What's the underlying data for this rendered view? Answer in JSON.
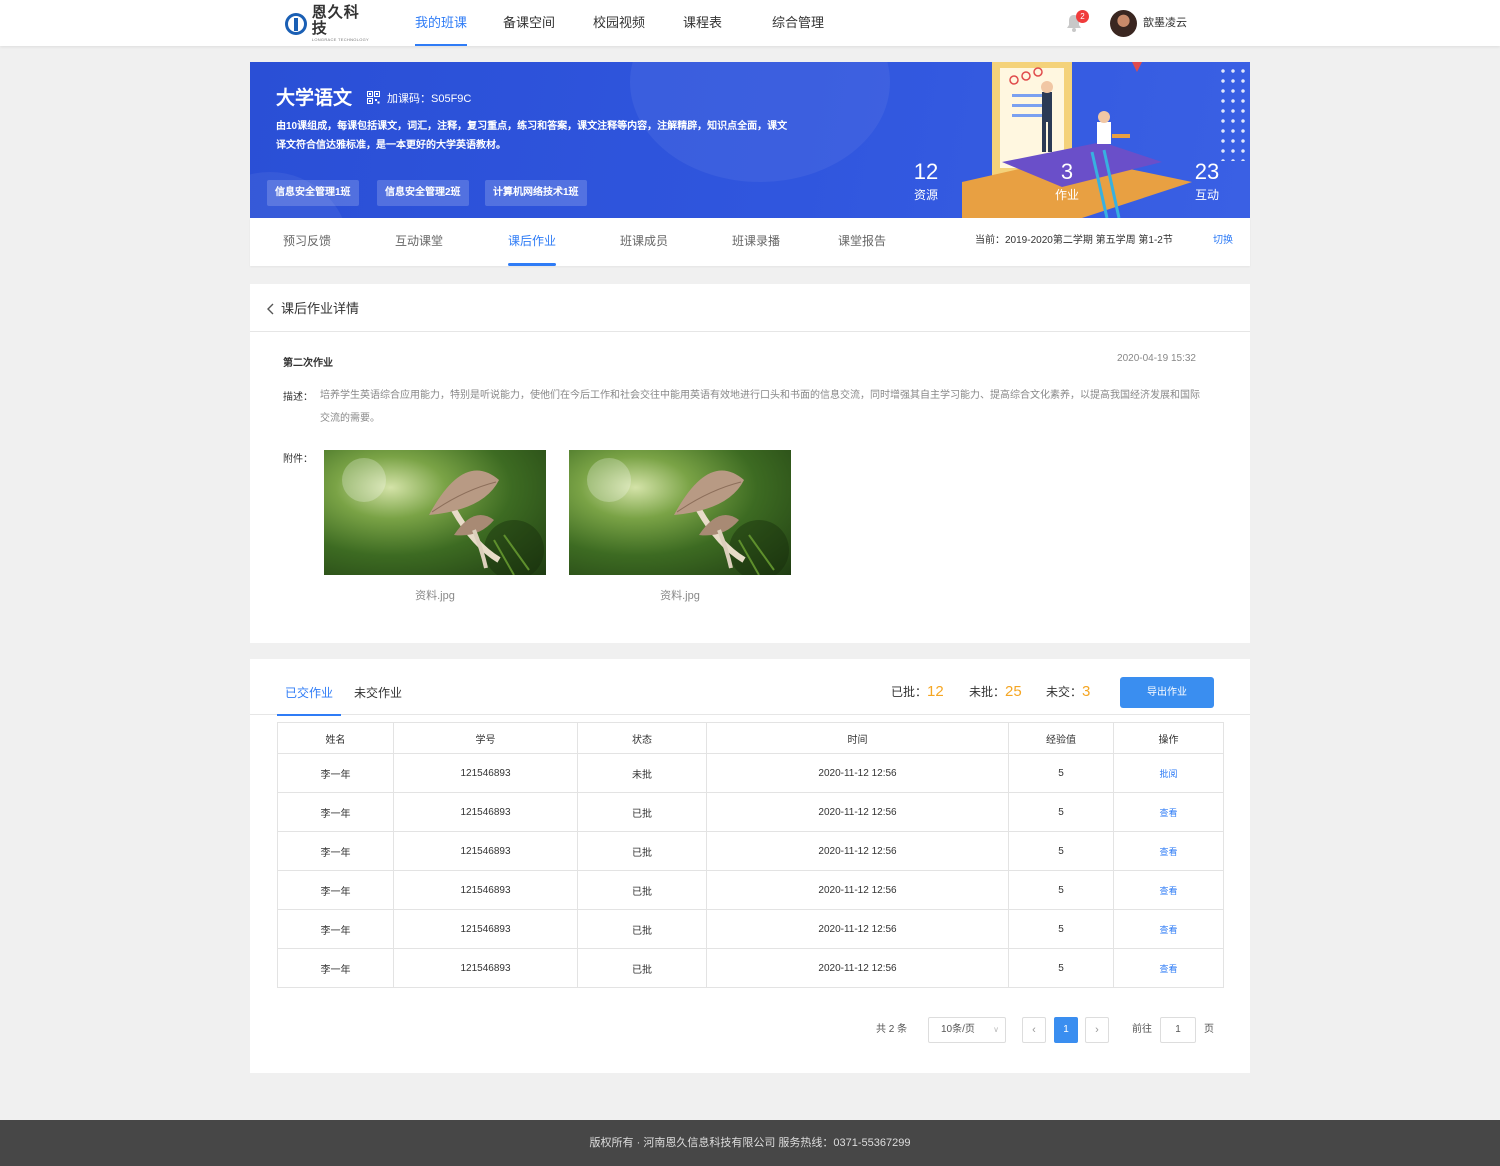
{
  "brand": {
    "name": "恩久科技",
    "sub": "LONGRACE TECHNOLOGY"
  },
  "nav": {
    "items": [
      {
        "label": "我的班课",
        "active": true
      },
      {
        "label": "备课空间"
      },
      {
        "label": "校园视频"
      },
      {
        "label": "课程表"
      },
      {
        "label": "综合管理"
      }
    ],
    "notification_count": "2",
    "username": "歆墨凌云"
  },
  "banner": {
    "title": "大学语文",
    "join_code": "加课码：S05F9C",
    "description": "由10课组成，每课包括课文，词汇，注释，复习重点，练习和答案，课文注释等内容，注解精辟，知识点全面，课文译文符合信达雅标准，是一本更好的大学英语教材。",
    "classes": [
      "信息安全管理1班",
      "信息安全管理2班",
      "计算机网络技术1班"
    ],
    "stats": [
      {
        "value": "12",
        "label": "资源"
      },
      {
        "value": "3",
        "label": "作业"
      },
      {
        "value": "23",
        "label": "互动"
      }
    ]
  },
  "subtabs": {
    "items": [
      {
        "label": "预习反馈"
      },
      {
        "label": "互动课堂"
      },
      {
        "label": "课后作业",
        "active": true
      },
      {
        "label": "班课成员"
      },
      {
        "label": "班课录播"
      },
      {
        "label": "课堂报告"
      }
    ],
    "term": "当前：2019-2020第二学期   第五学周  第1-2节",
    "switch_label": "切换"
  },
  "detail": {
    "title": "课后作业详情",
    "homework_name": "第二次作业",
    "date": "2020-04-19    15:32",
    "desc_label": "描述：",
    "description": "培养学生英语综合应用能力，特别是听说能力，使他们在今后工作和社会交往中能用英语有效地进行口头和书面的信息交流，同时增强其自主学习能力、提高综合文化素养，以提高我国经济发展和国际交流的需要。",
    "attach_label": "附件：",
    "attachments": [
      {
        "name": "资料.jpg"
      },
      {
        "name": "资料.jpg"
      }
    ]
  },
  "submissions": {
    "tabs": [
      {
        "label": "已交作业",
        "active": true
      },
      {
        "label": "未交作业"
      }
    ],
    "counts": {
      "graded_label": "已批：",
      "graded": "12",
      "ungraded_label": "未批：",
      "ungraded": "25",
      "unsubmitted_label": "未交：",
      "unsubmitted": "3"
    },
    "export_label": "导出作业",
    "columns": [
      "姓名",
      "学号",
      "状态",
      "时间",
      "经验值",
      "操作"
    ],
    "rows": [
      {
        "name": "李一年",
        "id": "121546893",
        "status": "未批",
        "time": "2020-11-12  12:56",
        "exp": "5",
        "action": "批阅"
      },
      {
        "name": "李一年",
        "id": "121546893",
        "status": "已批",
        "time": "2020-11-12  12:56",
        "exp": "5",
        "action": "查看"
      },
      {
        "name": "李一年",
        "id": "121546893",
        "status": "已批",
        "time": "2020-11-12  12:56",
        "exp": "5",
        "action": "查看"
      },
      {
        "name": "李一年",
        "id": "121546893",
        "status": "已批",
        "time": "2020-11-12  12:56",
        "exp": "5",
        "action": "查看"
      },
      {
        "name": "李一年",
        "id": "121546893",
        "status": "已批",
        "time": "2020-11-12  12:56",
        "exp": "5",
        "action": "查看"
      },
      {
        "name": "李一年",
        "id": "121546893",
        "status": "已批",
        "time": "2020-11-12  12:56",
        "exp": "5",
        "action": "查看"
      }
    ]
  },
  "pagination": {
    "total": "共 2 条",
    "page_size": "10条/页",
    "current_page": "1",
    "goto_label": "前往",
    "goto_value": "1",
    "page_suffix": "页"
  },
  "footer": {
    "text": "版权所有 · 河南恩久信息科技有限公司   服务热线：0371-55367299"
  },
  "colors": {
    "accent": "#2f7cf6",
    "banner": "#3056de",
    "warning": "#f5a623",
    "footer": "#474747"
  }
}
